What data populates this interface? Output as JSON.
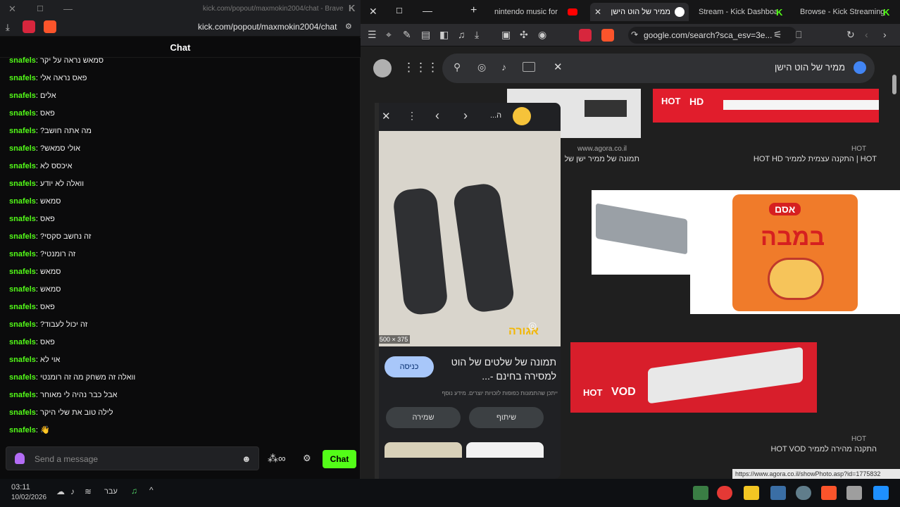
{
  "left_window": {
    "title_url": "kick.com/popout/maxmokin2004/chat - Brave",
    "url": "kick.com/popout/maxmokin2004/chat",
    "chat_header": "Chat",
    "messages": [
      {
        "user": "snafels",
        "text": "סמאש נראה על יקר"
      },
      {
        "user": "snafels",
        "text": "פאס נראה אלי"
      },
      {
        "user": "snafels",
        "text": "אלים"
      },
      {
        "user": "snafels",
        "text": "פאס"
      },
      {
        "user": "snafels",
        "text": "מה אתה חושב?"
      },
      {
        "user": "snafels",
        "text": "אולי סמאש?"
      },
      {
        "user": "snafels",
        "text": "איכסס לא"
      },
      {
        "user": "snafels",
        "text": "וואלה לא יודע"
      },
      {
        "user": "snafels",
        "text": "סמאש"
      },
      {
        "user": "snafels",
        "text": "פאס"
      },
      {
        "user": "snafels",
        "text": "זה נחשב סקסי?"
      },
      {
        "user": "snafels",
        "text": "זה רומנטי?"
      },
      {
        "user": "snafels",
        "text": "סמאש"
      },
      {
        "user": "snafels",
        "text": "סמאש"
      },
      {
        "user": "snafels",
        "text": "פאס"
      },
      {
        "user": "snafels",
        "text": "זה יכול לעבוד?"
      },
      {
        "user": "snafels",
        "text": "פאס"
      },
      {
        "user": "snafels",
        "text": "אוי לא"
      },
      {
        "user": "snafels",
        "text": "וואלה זה משחק מה זה רומנטי"
      },
      {
        "user": "snafels",
        "text": "אבל כבר נהיה לי מאוחר"
      },
      {
        "user": "snafels",
        "text": "לילה טוב את שלי היקר"
      },
      {
        "user": "snafels",
        "text": "👋"
      }
    ],
    "input_placeholder": "Send a message",
    "chat_button": "Chat"
  },
  "right_window": {
    "tabs": [
      {
        "label": "nintendo music for"
      },
      {
        "label": "ממיר של הוט הישן"
      },
      {
        "label": "Stream - Kick Dashboa"
      },
      {
        "label": "Browse - Kick Streaming"
      }
    ],
    "url": "google.com/search?sca_esv=3e...",
    "search_query": "ממיר של הוט הישן",
    "panel": {
      "title_short": "...ה",
      "dims": "500 × 375",
      "title": "תמונה של שלטים של הוט למסירה בחינם -...",
      "visit_btn": "כניסה",
      "note": "ייתכן שהתמונות כפופות לזכויות יוצרים. מידע נוסף",
      "share_btn": "שיתוף",
      "save_btn": "שמירה",
      "watermark": "אגורה"
    },
    "results": [
      {
        "source": "www.agora.co.il",
        "title": "תמונה של ממיר ישן של"
      },
      {
        "source": "HOT",
        "title": "HOT | התקנה עצמית לממיר HOT HD"
      },
      {
        "source": "HOT",
        "title": "התקנה מהירה לממיר HOT VOD"
      }
    ],
    "banner_hd": "HD",
    "banner_hot": "HOT",
    "banner_vod": "VOD",
    "bamba_brand": "אסם",
    "bamba_name": "במבה",
    "status_url": "https://www.agora.co.il/showPhoto.asp?id=1775832"
  },
  "taskbar": {
    "time": "03:11",
    "date": "10/02/2026",
    "lang": "עבר"
  }
}
